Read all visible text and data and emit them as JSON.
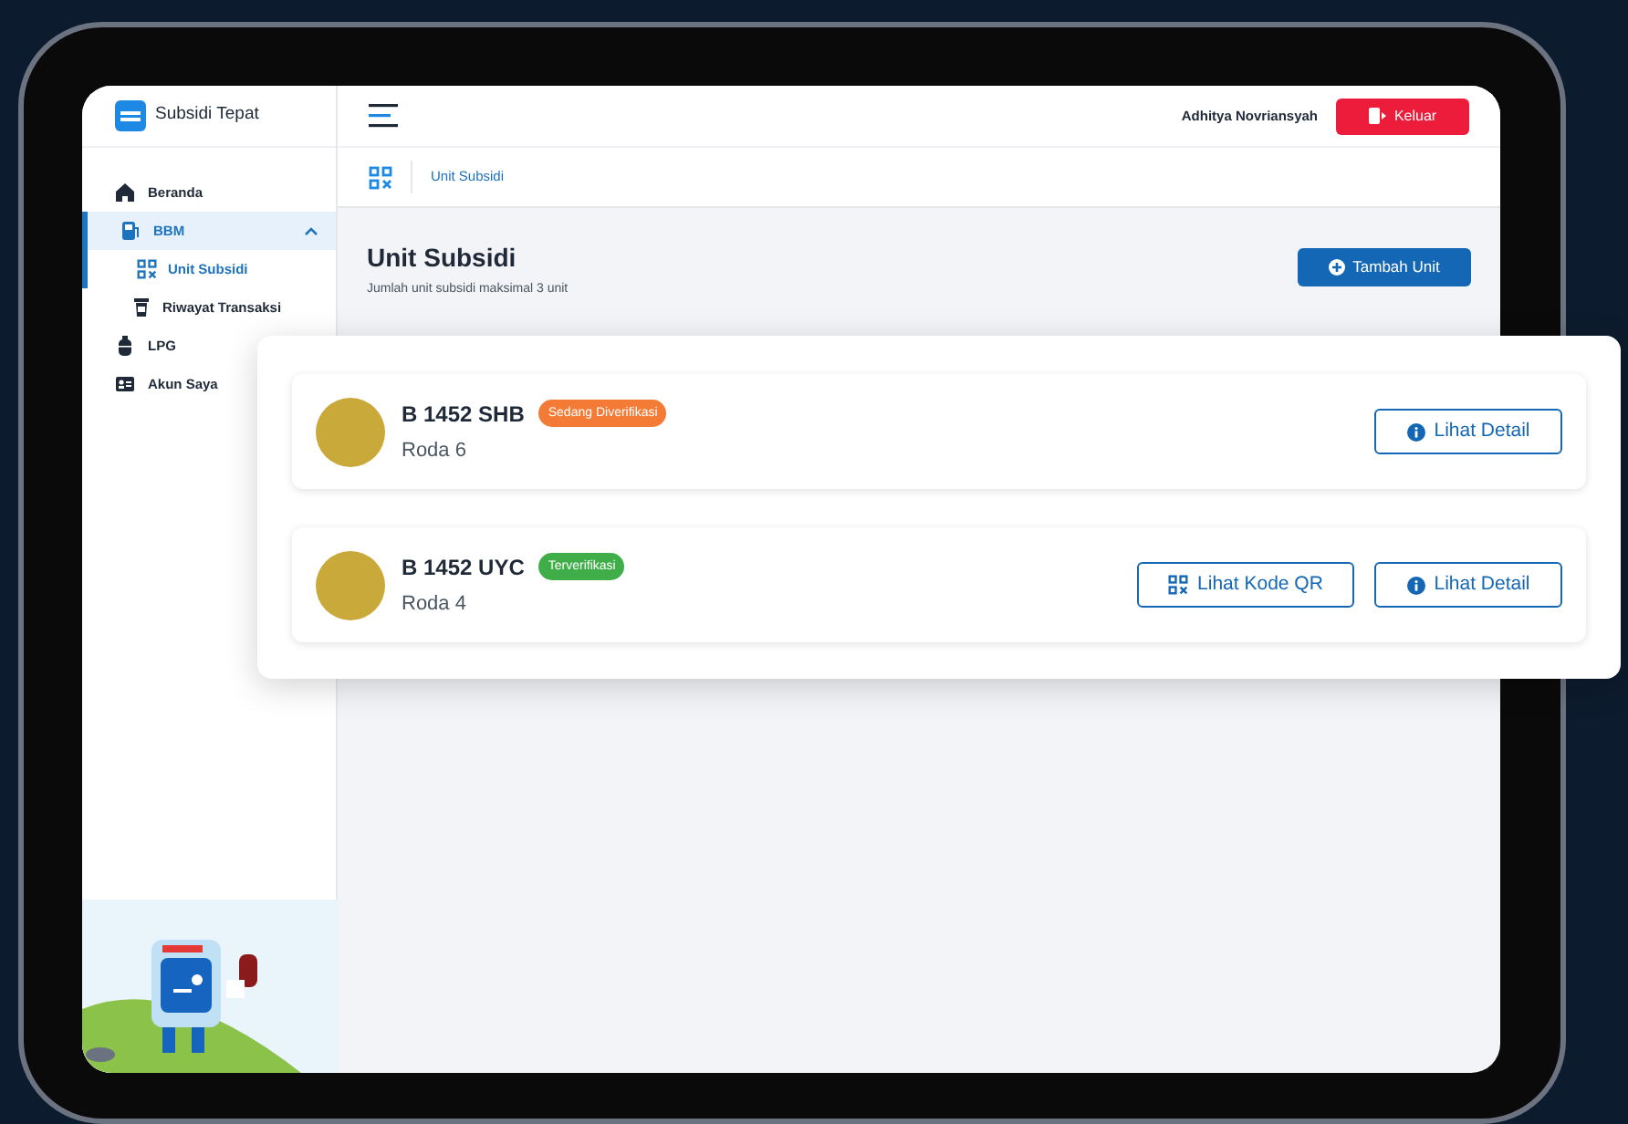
{
  "app": {
    "title": "Subsidi Tepat"
  },
  "sidebar": {
    "items": [
      {
        "label": "Beranda",
        "kind": "home",
        "selected": false
      },
      {
        "label": "BBM",
        "kind": "fuel",
        "selected": true,
        "expanded": true,
        "children": [
          {
            "label": "Unit Subsidi",
            "kind": "qr",
            "selected": true
          },
          {
            "label": "Riwayat Transaksi",
            "kind": "cup",
            "selected": false
          }
        ]
      },
      {
        "label": "LPG",
        "kind": "gas",
        "selected": false
      },
      {
        "label": "Akun Saya",
        "kind": "card",
        "selected": false
      }
    ]
  },
  "header": {
    "user_name": "Adhitya Novriansyah",
    "logout_button": "Keluar"
  },
  "breadcrumb": "Unit Subsidi",
  "page": {
    "title": "Unit Subsidi",
    "subtitle": "Jumlah unit subsidi maksimal 3 unit",
    "add_button": "Tambah Unit"
  },
  "units": [
    {
      "plate": "B 1452 SHB",
      "status": "Sedang Diverifikasi",
      "color": "#f47b36",
      "wheels": "Roda 6",
      "buttons": [
        {
          "kind": "detail",
          "label": "Lihat Detail"
        }
      ]
    },
    {
      "plate": "B 1452 UYC",
      "status": "Terverifikasi",
      "color": "#3fae49",
      "wheels": "Roda 4",
      "buttons": [
        {
          "kind": "qr",
          "label": "Lihat Kode QR"
        },
        {
          "kind": "detail",
          "label": "Lihat Detail"
        }
      ]
    }
  ]
}
